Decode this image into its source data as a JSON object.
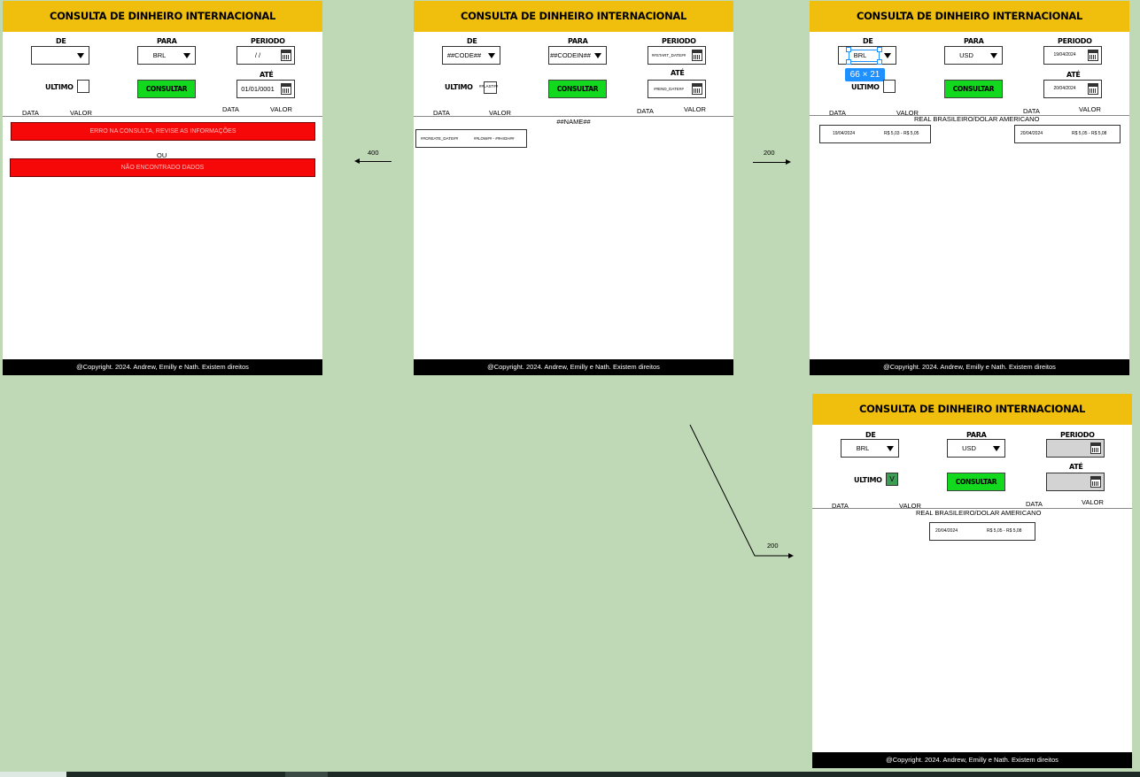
{
  "header_title": "CONSULTA DE DINHEIRO INTERNACIONAL",
  "footer_text": "@Copyright. 2024. Andrew, Emilly e Nath. Existem direitos",
  "labels": {
    "de": "DE",
    "para": "PARA",
    "periodo": "PERIODO",
    "ate": "ATÉ",
    "ultimo": "ULTIMO",
    "consultar": "CONSULTAR",
    "data": "DATA",
    "valor": "VALOR"
  },
  "screen_error": {
    "de_value": "",
    "para_value": "BRL",
    "periodo_value": "/ /",
    "ate_value": "01/01/0001",
    "error_message": "ERRO NA CONSULTA, REVISE AS INFORMAÇÕES",
    "ou": "OU",
    "not_found_message": "NÃO ENCONTRADO DADOS"
  },
  "screen_template": {
    "de_value": "##CODE##",
    "para_value": "##CODEIN##",
    "periodo_value": "##START_DATE##",
    "ate_value": "##END_DATE##",
    "last_value": "##LAST##",
    "name": "##NAME##",
    "row_date": "##CREATE_DATE##",
    "row_value": "##LOW## - ##HIGH##"
  },
  "screen_period": {
    "de_value": "BRL",
    "para_value": "USD",
    "periodo_value": "19/04/2024",
    "ate_value": "20/04/2024",
    "name": "REAL BRASILEIRO/DOLAR AMERICANO",
    "rows": [
      {
        "date": "19/04/2024",
        "value": "R$ 5,03 - R$ 5,05"
      },
      {
        "date": "20/04/2024",
        "value": "R$ 5,05 - R$ 5,08"
      }
    ],
    "size_badge": "66 × 21"
  },
  "screen_last": {
    "de_value": "BRL",
    "para_value": "USD",
    "ultimo_checked": "V",
    "name": "REAL BRASILEIRO/DOLAR AMERICANO",
    "rows": [
      {
        "date": "20/04/2024",
        "value": "R$ 5,05 - R$ 5,08"
      }
    ]
  },
  "arrows": {
    "to_error": "400",
    "to_period": "200",
    "to_last": "200"
  }
}
